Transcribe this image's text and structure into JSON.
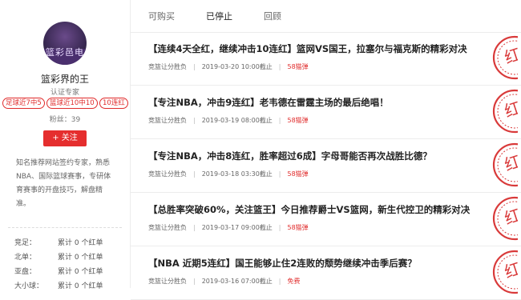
{
  "profile": {
    "avatar_text": "篮彩邑电",
    "name": "篮彩界的王",
    "role": "认证专家",
    "tags": [
      "足球近7中5",
      "篮球近10中10",
      "10连红"
    ],
    "fans": "粉丝：39",
    "follow_label": "+ 关注",
    "bio": "知名推荐网站签约专家，熟悉NBA、国际篮球赛事，专研体育赛事的开盘技巧，解盘精准。",
    "stats": [
      {
        "k": "竞足：",
        "v": "累计 0 个红单"
      },
      {
        "k": "北单：",
        "v": "累计 0 个红单"
      },
      {
        "k": "亚盘：",
        "v": "累计 0 个红单"
      },
      {
        "k": "大小球：",
        "v": "累计 0 个红单"
      }
    ]
  },
  "tabs": [
    {
      "label": "可购买",
      "active": false
    },
    {
      "label": "已停止",
      "active": true
    },
    {
      "label": "回顾",
      "active": false
    }
  ],
  "items": [
    {
      "title": "【连续4天全红，继续冲击10连红】篮网VS国王，拉塞尔与福克斯的精彩对决",
      "category": "竞篮让分胜负",
      "time": "2019-03-20 10:00截止",
      "price": "58猫弹",
      "stamp": "红"
    },
    {
      "title": "【专注NBA，冲击9连红】老韦德在雷霆主场的最后绝唱！",
      "category": "竞篮让分胜负",
      "time": "2019-03-19 08:00截止",
      "price": "58猫弹",
      "stamp": "红"
    },
    {
      "title": "【专注NBA，冲击8连红，胜率超过6成】字母哥能否再次战胜比德？",
      "category": "竞篮让分胜负",
      "time": "2019-03-18 03:30截止",
      "price": "58猫弹",
      "stamp": "红"
    },
    {
      "title": "【总胜率突破60%，关注篮王】今日推荐爵士VS篮网，新生代控卫的精彩对决",
      "category": "竞篮让分胜负",
      "time": "2019-03-17 09:00截止",
      "price": "58猫弹",
      "stamp": "红"
    },
    {
      "title": "【NBA 近期5连红】国王能够止住2连败的颓势继续冲击季后赛？",
      "category": "竞篮让分胜负",
      "time": "2019-03-16 07:00截止",
      "price": "免费",
      "stamp": "红"
    }
  ],
  "colors": {
    "accent": "#e52e2e",
    "stamp": "#d93a3a"
  }
}
